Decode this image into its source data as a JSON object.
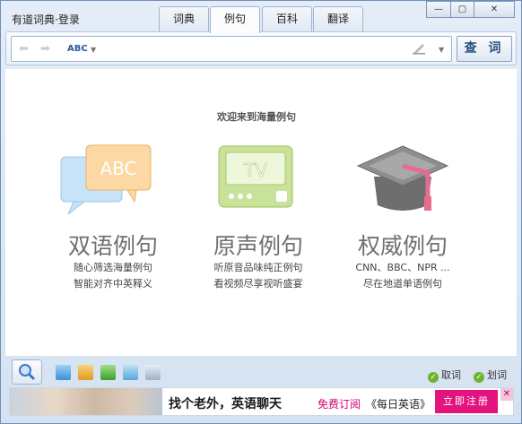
{
  "window": {
    "title": "有道词典",
    "login": "登录",
    "tabs": [
      "词典",
      "例句",
      "百科",
      "翻译"
    ],
    "active_tab": "例句",
    "controls": {
      "minimize": "—",
      "restore": "▢",
      "close": "✕"
    }
  },
  "search": {
    "lang_icon": "ABC",
    "placeholder": "",
    "value": "",
    "button_label": "查 词"
  },
  "content": {
    "welcome": "欢迎来到海量例句",
    "features": [
      {
        "icon": "abc-bubble-icon",
        "icon_text": "ABC",
        "title": "双语例句",
        "line1": "随心筛选海量例句",
        "line2": "智能对齐中英释义"
      },
      {
        "icon": "tv-icon",
        "icon_text": "TV",
        "title": "原声例句",
        "line1": "听原音品味纯正例句",
        "line2": "看视频尽享视听盛宴"
      },
      {
        "icon": "graduation-cap-icon",
        "icon_text": "",
        "title": "权威例句",
        "line1": "CNN、BBC、NPR ...",
        "line2": "尽在地道单语例句"
      }
    ]
  },
  "toolbar": {
    "capture_word": "取词",
    "select_word": "划词"
  },
  "ad": {
    "main": "找个老外，英语聊天",
    "sub": "免费订阅",
    "sub2": "《每日英语》",
    "button": "立即注册",
    "close": "✕"
  },
  "colors": {
    "accent": "#2b4f80",
    "ad_pink": "#e3147f",
    "check_green": "#6fb32c"
  }
}
